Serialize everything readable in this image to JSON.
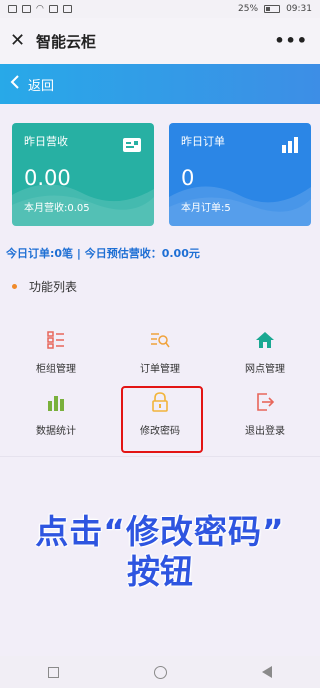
{
  "status_bar": {
    "battery": "25%",
    "time": "09:31"
  },
  "title_bar": {
    "title": "智能云柜",
    "more": "•••"
  },
  "back_bar": {
    "label": "返回"
  },
  "cards": {
    "revenue": {
      "title": "昨日营收",
      "value": "0.00",
      "sub": "本月营收:0.05"
    },
    "orders": {
      "title": "昨日订单",
      "value": "0",
      "sub": "本月订单:5"
    }
  },
  "summary": "今日订单:0笔 | 今日预估营收：0.00元",
  "section_title": "功能列表",
  "functions": [
    {
      "label": "柜组管理",
      "icon": "cabinet-list-icon",
      "color": "#e8665a"
    },
    {
      "label": "订单管理",
      "icon": "order-search-icon",
      "color": "#f0a23c"
    },
    {
      "label": "网点管理",
      "icon": "home-icon",
      "color": "#1aa892"
    },
    {
      "label": "数据统计",
      "icon": "bar-chart-icon",
      "color": "#7ab03c"
    },
    {
      "label": "修改密码",
      "icon": "lock-icon",
      "color": "#f2b43a"
    },
    {
      "label": "退出登录",
      "icon": "logout-icon",
      "color": "#e8665a"
    }
  ],
  "overlay": {
    "line1": "点击“修改密码”",
    "line2": "按钮"
  },
  "colors": {
    "accent_blue": "#2b86e6",
    "accent_green": "#27b0a3",
    "highlight": "#e31414"
  }
}
